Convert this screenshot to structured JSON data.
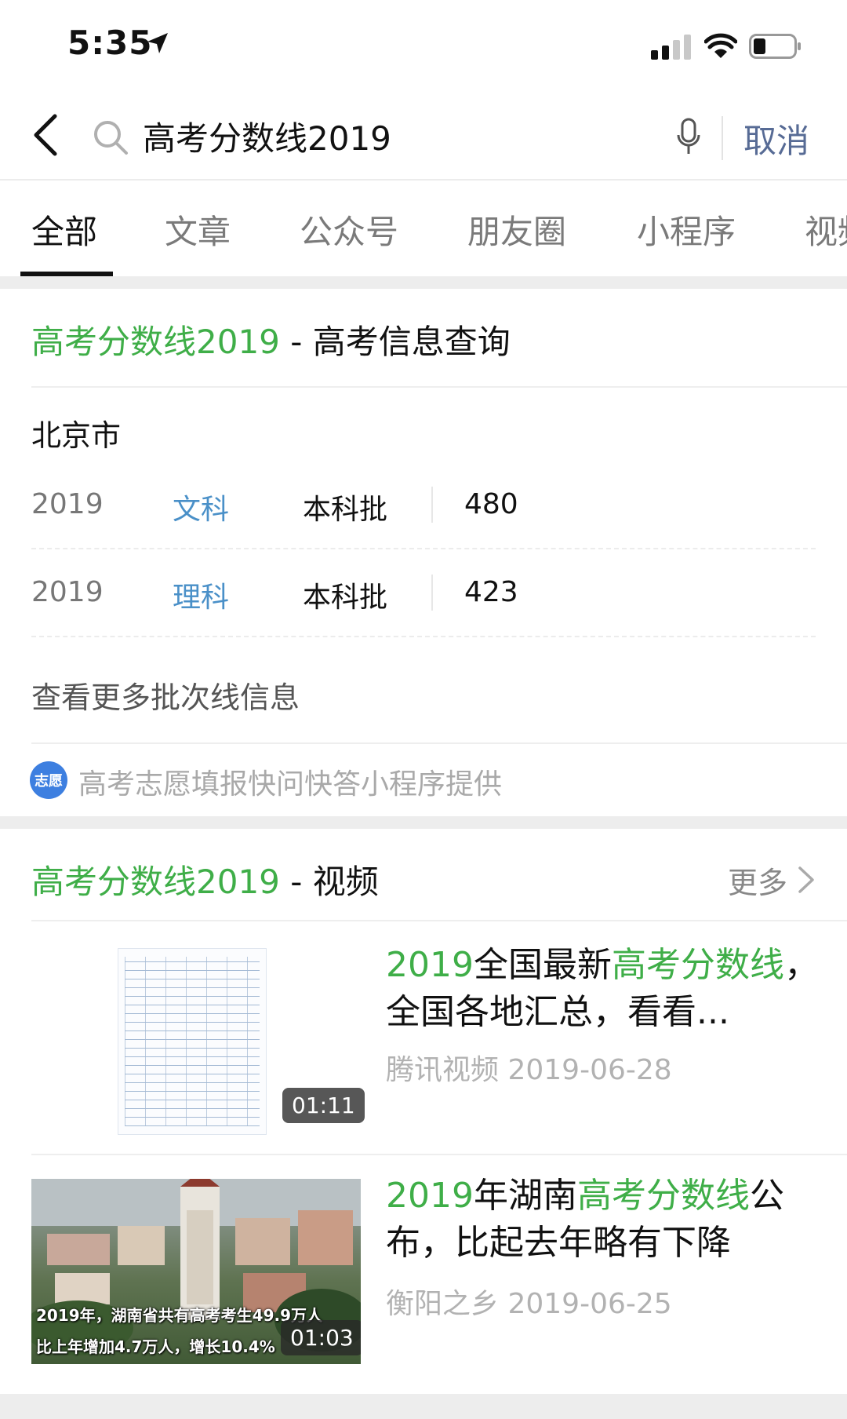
{
  "status_bar": {
    "time": "5:35"
  },
  "search": {
    "query": "高考分数线2019",
    "cancel_label": "取消"
  },
  "tabs": [
    {
      "label": "全部",
      "active": true
    },
    {
      "label": "文章"
    },
    {
      "label": "公众号"
    },
    {
      "label": "朋友圈"
    },
    {
      "label": "小程序"
    },
    {
      "label": "视频"
    }
  ],
  "score_card": {
    "title_highlight": "高考分数线2019",
    "title_suffix": " - 高考信息查询",
    "city": "北京市",
    "rows": [
      {
        "year": "2019",
        "subject": "文科",
        "batch": "本科批",
        "score": "480"
      },
      {
        "year": "2019",
        "subject": "理科",
        "batch": "本科批",
        "score": "423"
      }
    ],
    "more_link": "查看更多批次线信息",
    "provider_badge": "志愿",
    "provider": "高考志愿填报快问快答小程序提供"
  },
  "video_section": {
    "title_highlight": "高考分数线2019",
    "title_suffix": " - 视频",
    "more_label": "更多",
    "items": [
      {
        "title_parts": [
          {
            "text": "2019",
            "hl": true
          },
          {
            "text": "全国最新",
            "hl": false
          },
          {
            "text": "高考分数线",
            "hl": true
          },
          {
            "text": "，全国各地汇总，看看...",
            "hl": false
          }
        ],
        "source": "腾讯视频",
        "date": "2019-06-28",
        "duration": "01:11"
      },
      {
        "title_parts": [
          {
            "text": "2019",
            "hl": true
          },
          {
            "text": "年湖南",
            "hl": false
          },
          {
            "text": "高考分数线",
            "hl": true
          },
          {
            "text": "公布，比起去年略有下降",
            "hl": false
          }
        ],
        "source": "衡阳之乡",
        "date": "2019-06-25",
        "duration": "01:03",
        "overlay_line1": "2019年，湖南省共有高考考生49.9万人",
        "overlay_line2": "比上年增加4.7万人，增长10.4%"
      }
    ]
  },
  "colors": {
    "highlight": "#3fae48",
    "link_blue": "#576b95",
    "subject_blue": "#4a90c8"
  }
}
